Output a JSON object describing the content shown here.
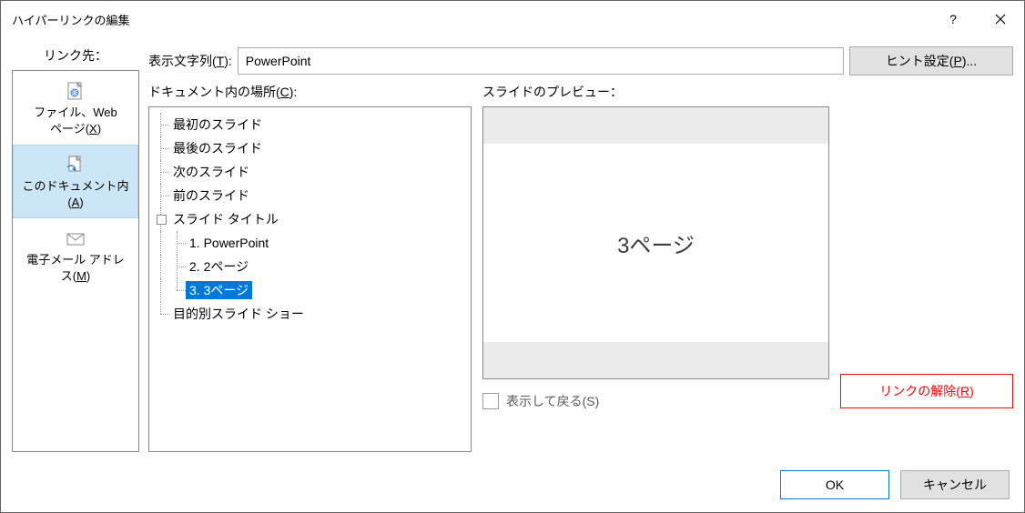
{
  "title": "ハイパーリンクの編集",
  "sidebar_label": "リンク先：",
  "sidebar": {
    "items": [
      {
        "line1": "ファイル、Web",
        "line2_pre": "ページ(",
        "line2_u": "X",
        "line2_post": ")"
      },
      {
        "line1": "このドキュメント内",
        "line2_pre": "(",
        "line2_u": "A",
        "line2_post": ")"
      },
      {
        "line1": "電子メール アドレ",
        "line2_pre": "ス(",
        "line2_u": "M",
        "line2_post": ")"
      }
    ]
  },
  "display_label_pre": "表示文字列(",
  "display_label_u": "T",
  "display_label_post": "):",
  "display_value": "PowerPoint",
  "hint_button_pre": "ヒント設定(",
  "hint_button_u": "P",
  "hint_button_post": ")...",
  "location_label_pre": "ドキュメント内の場所(",
  "location_label_u": "C",
  "location_label_post": "):",
  "tree": {
    "first": "最初のスライド",
    "last": "最後のスライド",
    "next": "次のスライド",
    "prev": "前のスライド",
    "titles": "スライド タイトル",
    "s1": "1. PowerPoint",
    "s2": "2. 2ページ",
    "s3": "3. 3ページ",
    "custom": "目的別スライド ショー"
  },
  "preview_label": "スライドのプレビュー：",
  "preview_slide_text": "3ページ",
  "show_return_pre": "表示して戻る(",
  "show_return_u": "S",
  "show_return_post": ")",
  "remove_link_pre": "リンクの解除(",
  "remove_link_u": "R",
  "remove_link_post": ")",
  "ok": "OK",
  "cancel": "キャンセル"
}
